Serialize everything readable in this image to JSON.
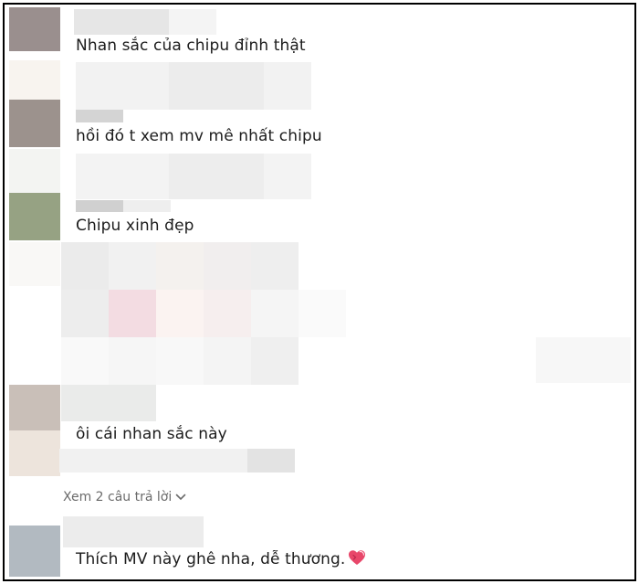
{
  "comments": [
    {
      "text": "Nhan sắc của chipu đỉnh thật"
    },
    {
      "text": "hồi đó t xem mv mê nhất chipu"
    },
    {
      "text": "Chipu xinh đẹp"
    },
    {
      "text": "ôi cái nhan sắc này"
    },
    {
      "text": "Thích MV này ghê nha, dễ thương.",
      "emoji": "heart-icon"
    }
  ],
  "view_replies": {
    "label": "Xem 2 câu trả lời",
    "icon": "chevron-down-icon"
  },
  "colors": {
    "text": "#1c1c1c",
    "muted": "#6b6b6b",
    "heart": "#e8476a",
    "border": "#000000"
  }
}
